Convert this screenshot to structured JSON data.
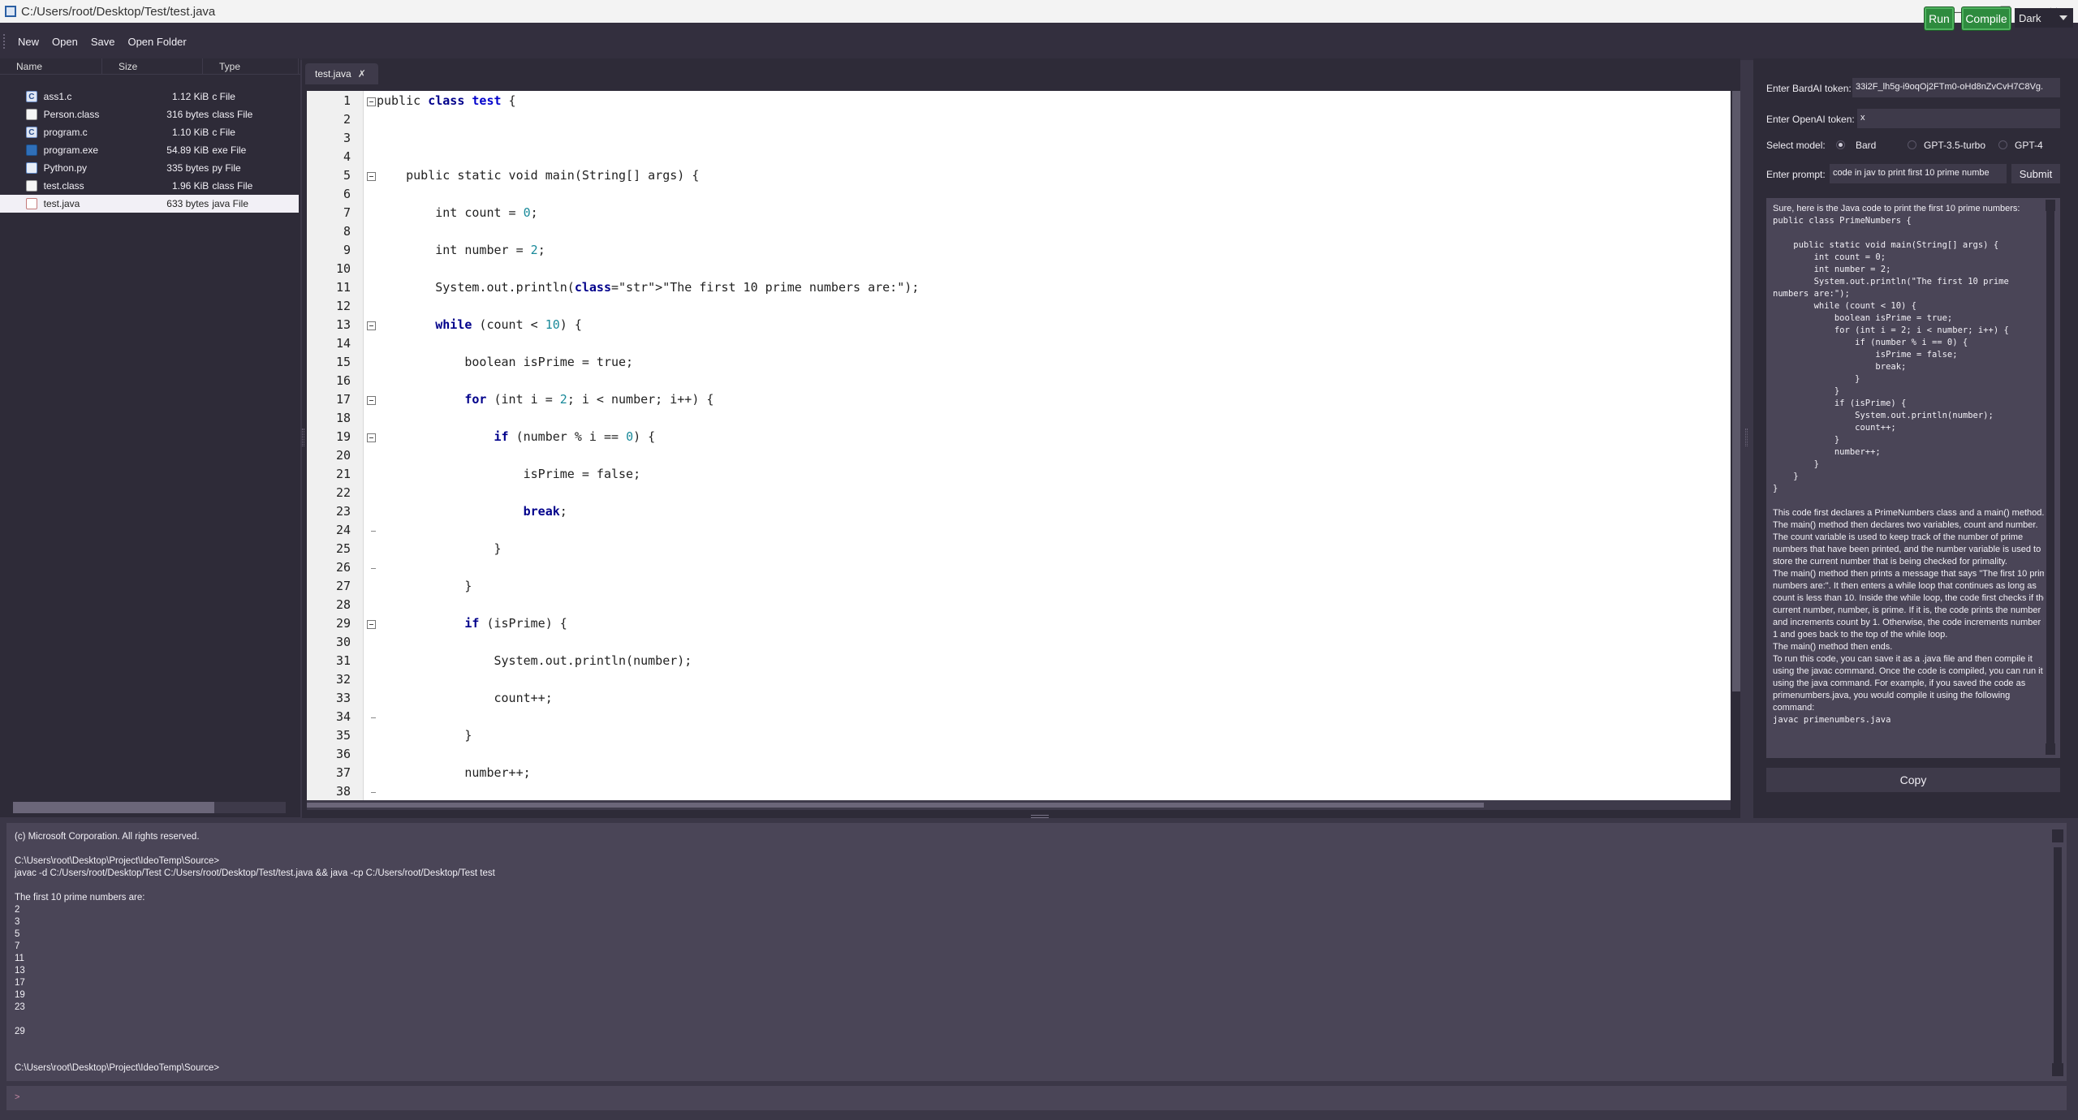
{
  "window": {
    "title": "C:/Users/root/Desktop/Test/test.java",
    "controls": [
      "—",
      "❐",
      "✕"
    ]
  },
  "toolbar": {
    "menu": [
      "New",
      "Open",
      "Save",
      "Open Folder"
    ],
    "run_label": "Run",
    "compile_label": "Compile",
    "theme_value": "Dark"
  },
  "files": {
    "headers": [
      "Name",
      "Size",
      "Type"
    ],
    "rows": [
      {
        "name": "ass1.c",
        "size": "1.12 KiB",
        "type": "c File",
        "icon": "c-file-icon",
        "glyph": "C",
        "selected": false
      },
      {
        "name": "Person.class",
        "size": "316 bytes",
        "type": "class File",
        "icon": "generic-file-icon",
        "glyph": "",
        "selected": false
      },
      {
        "name": "program.c",
        "size": "1.10 KiB",
        "type": "c File",
        "icon": "c-file-icon",
        "glyph": "C",
        "selected": false
      },
      {
        "name": "program.exe",
        "size": "54.89 KiB",
        "type": "exe File",
        "icon": "exe-file-icon",
        "glyph": "",
        "selected": false
      },
      {
        "name": "Python.py",
        "size": "335 bytes",
        "type": "py File",
        "icon": "python-file-icon",
        "glyph": "",
        "selected": false
      },
      {
        "name": "test.class",
        "size": "1.96 KiB",
        "type": "class File",
        "icon": "generic-file-icon",
        "glyph": "",
        "selected": false
      },
      {
        "name": "test.java",
        "size": "633 bytes",
        "type": "java File",
        "icon": "java-file-icon",
        "glyph": "",
        "selected": true
      }
    ]
  },
  "editor": {
    "tab_label": "test.java",
    "line_numbers": [
      "1",
      "2",
      "3",
      "4",
      "5",
      "6",
      "7",
      "8",
      "9",
      "10",
      "11",
      "12",
      "13",
      "14",
      "15",
      "16",
      "17",
      "18",
      "19",
      "20",
      "21",
      "22",
      "23",
      "24",
      "25",
      "26",
      "27",
      "28",
      "29",
      "30",
      "31",
      "32",
      "33",
      "34",
      "35",
      "36",
      "37",
      "38"
    ],
    "lines": [
      "public class test {",
      "",
      "",
      "",
      "    public static void main(String[] args) {",
      "",
      "        int count = 0;",
      "",
      "        int number = 2;",
      "",
      "        System.out.println(\"The first 10 prime numbers are:\");",
      "",
      "        while (count < 10) {",
      "",
      "            boolean isPrime = true;",
      "",
      "            for (int i = 2; i < number; i++) {",
      "",
      "                if (number % i == 0) {",
      "",
      "                    isPrime = false;",
      "",
      "                    break;",
      "",
      "                }",
      "",
      "            }",
      "",
      "            if (isPrime) {",
      "",
      "                System.out.println(number);",
      "",
      "                count++;",
      "",
      "            }",
      "",
      "            number++;",
      ""
    ]
  },
  "ai_panel": {
    "bard_label": "Enter BardAI token:",
    "bard_value": "33i2F_lh5g-i9oqOj2FTm0-oHd8nZvCvH7C8Vg.",
    "openai_label": "Enter OpenAI token:",
    "openai_value": "x",
    "model_label": "Select model:",
    "models": [
      "Bard",
      "GPT-3.5-turbo",
      "GPT-4"
    ],
    "selected_model": "Bard",
    "prompt_label": "Enter prompt:",
    "prompt_value": "code in jav to print first 10 prime numbe",
    "submit_label": "Submit",
    "copy_label": "Copy",
    "response_intro": "Sure, here is the Java code to print the first 10 prime numbers:",
    "response_code": "public class PrimeNumbers {\n\n    public static void main(String[] args) {\n        int count = 0;\n        int number = 2;\n        System.out.println(\"The first 10 prime\nnumbers are:\");\n        while (count < 10) {\n            boolean isPrime = true;\n            for (int i = 2; i < number; i++) {\n                if (number % i == 0) {\n                    isPrime = false;\n                    break;\n                }\n            }\n            if (isPrime) {\n                System.out.println(number);\n                count++;\n            }\n            number++;\n        }\n    }\n}",
    "response_explanation": "This code first declares a PrimeNumbers class and a main() method. The main() method then declares two variables, count and number. The count variable is used to keep track of the number of prime numbers that have been printed, and the number variable is used to store the current number that is being checked for primality.\nThe main() method then prints a message that says \"The first 10 prime numbers are:\". It then enters a while loop that continues as long as count is less than 10. Inside the while loop, the code first checks if the current number, number, is prime. If it is, the code prints the number and increments count by 1. Otherwise, the code increments number by 1 and goes back to the top of the while loop.\nThe main() method then ends.\nTo run this code, you can save it as a .java file and then compile it using the javac command. Once the code is compiled, you can run it using the java command. For example, if you saved the code as primenumbers.java, you would compile it using the following command:",
    "response_tail": "javac primenumbers.java"
  },
  "terminal": {
    "lines": [
      "(c) Microsoft Corporation. All rights reserved.",
      "",
      "C:\\Users\\root\\Desktop\\Project\\IdeoTemp\\Source>",
      "javac -d C:/Users/root/Desktop/Test C:/Users/root/Desktop/Test/test.java && java -cp C:/Users/root/Desktop/Test test",
      "",
      "The first 10 prime numbers are:",
      "2",
      "3",
      "5",
      "7",
      "11",
      "13",
      "17",
      "19",
      "23",
      "",
      "29",
      "",
      "",
      "C:\\Users\\root\\Desktop\\Project\\IdeoTemp\\Source>"
    ],
    "input_value": ">"
  }
}
